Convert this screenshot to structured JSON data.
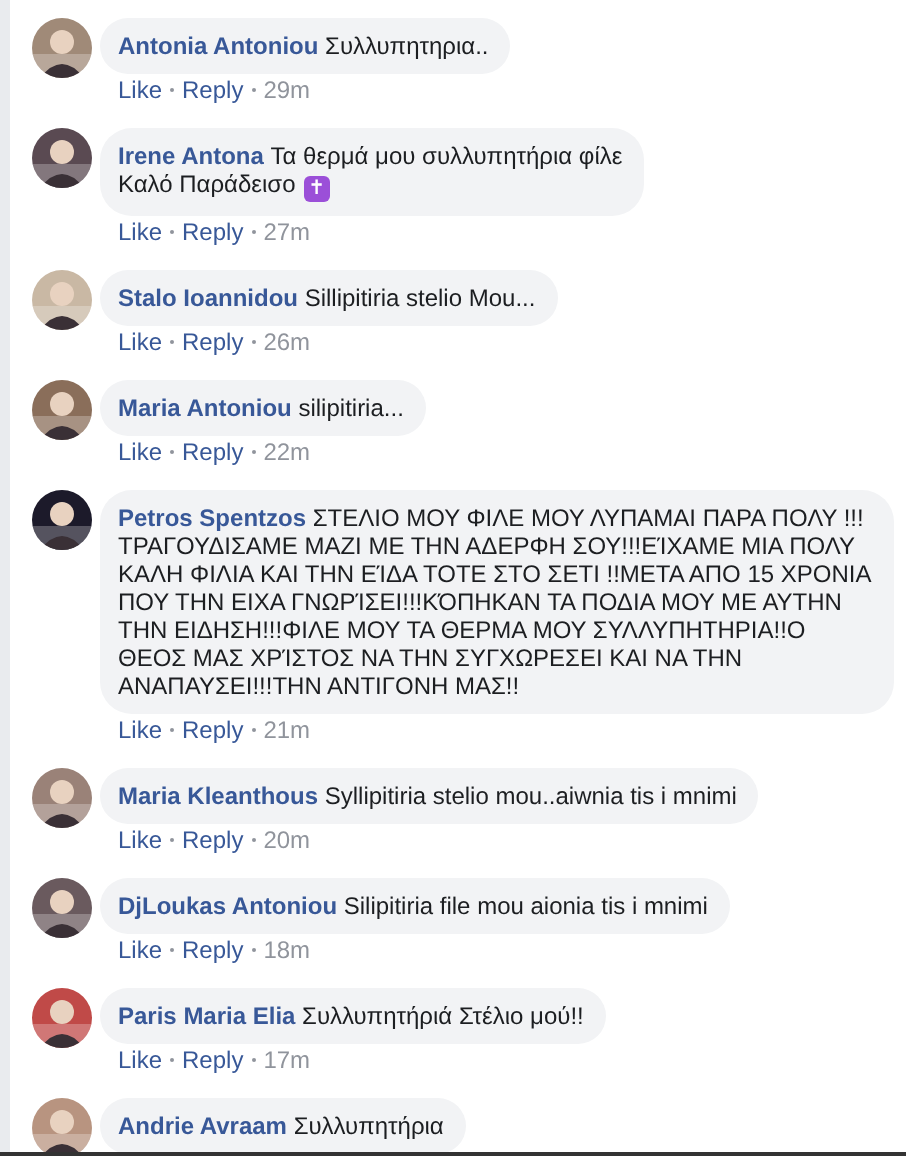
{
  "comments": [
    {
      "author": "Antonia Antoniou",
      "text": "Συλλυπητηρια..",
      "actions": [
        "Like",
        "Reply",
        "29m"
      ]
    },
    {
      "author": "Irene Antona",
      "text": "Τα θερμά μου συλλυπητήρια φίλε\nΚαλό Παράδεισο",
      "emoji": "✝",
      "actions": [
        "Like",
        "Reply",
        "27m"
      ]
    },
    {
      "author": "Stalo Ioannidou",
      "text": "Sillipitiria stelio Mou...",
      "actions": [
        "Like",
        "Reply",
        "26m"
      ]
    },
    {
      "author": "Maria Antoniou",
      "text": "silipitiria...",
      "actions": [
        "Like",
        "Reply",
        "22m"
      ]
    },
    {
      "author": "Petros Spentzos",
      "text": "ΣΤΕΛΙΟ ΜΟΥ ΦΙΛΕ ΜΟΥ ΛΥΠΑΜΑΙ ΠΑΡΑ ΠΟΛΥ !!!\nΤΡΑΓΟΥΔΙΣΑΜΕ ΜΑΖΙ ΜΕ ΤΗΝ ΑΔΕΡΦΗ ΣΟΥ!!!ΕΊΧΑΜΕ ΜΙΑ ΠΟΛΥ\nΚΑΛΗ ΦΙΛΙΑ ΚΑΙ ΤΗΝ ΕΊΔΑ ΤΟΤΕ ΣΤΟ ΣΕΤΙ !!ΜΕΤΑ ΑΠΟ 15 ΧΡΟΝΙΑ\nΠΟΥ ΤΗΝ ΕΙΧΑ ΓΝΩΡΊΣΕΙ!!!ΚΌΠΗΚΑΝ ΤΑ ΠΟΔΙΑ ΜΟΥ ΜΕ ΑΥΤΗΝ\nΤΗΝ ΕΙΔΗΣΗ!!!ΦΙΛΕ ΜΟΥ ΤΑ ΘΕΡΜΑ ΜΟΥ ΣΥΛΛΥΠΗΤΗΡΙΑ!!Ο\nΘΕΟΣ ΜΑΣ ΧΡΊΣΤΟΣ ΝΑ ΤΗΝ ΣΥΓΧΩΡΕΣΕΙ ΚΑΙ ΝΑ ΤΗΝ\nΑΝΑΠΑΥΣΕΙ!!!ΤΗΝ ΑΝΤΙΓΟΝΗ ΜΑΣ!!",
      "actions": [
        "Like",
        "Reply",
        "21m"
      ]
    },
    {
      "author": "Maria Kleanthous",
      "text": "Syllipitiria stelio mou..aiwnia tis i mnimi",
      "actions": [
        "Like",
        "Reply",
        "20m"
      ]
    },
    {
      "author": "DjLoukas Antoniou",
      "text": "Silipitiria file mou aionia tis i mnimi",
      "actions": [
        "Like",
        "Reply",
        "18m"
      ]
    },
    {
      "author": "Paris Maria Elia",
      "text": "Συλλυπητήριά Στέλιο μού!!",
      "actions": [
        "Like",
        "Reply",
        "17m"
      ]
    },
    {
      "author": "Andrie Avraam",
      "text": "Συλλυπητήρια"
    }
  ]
}
